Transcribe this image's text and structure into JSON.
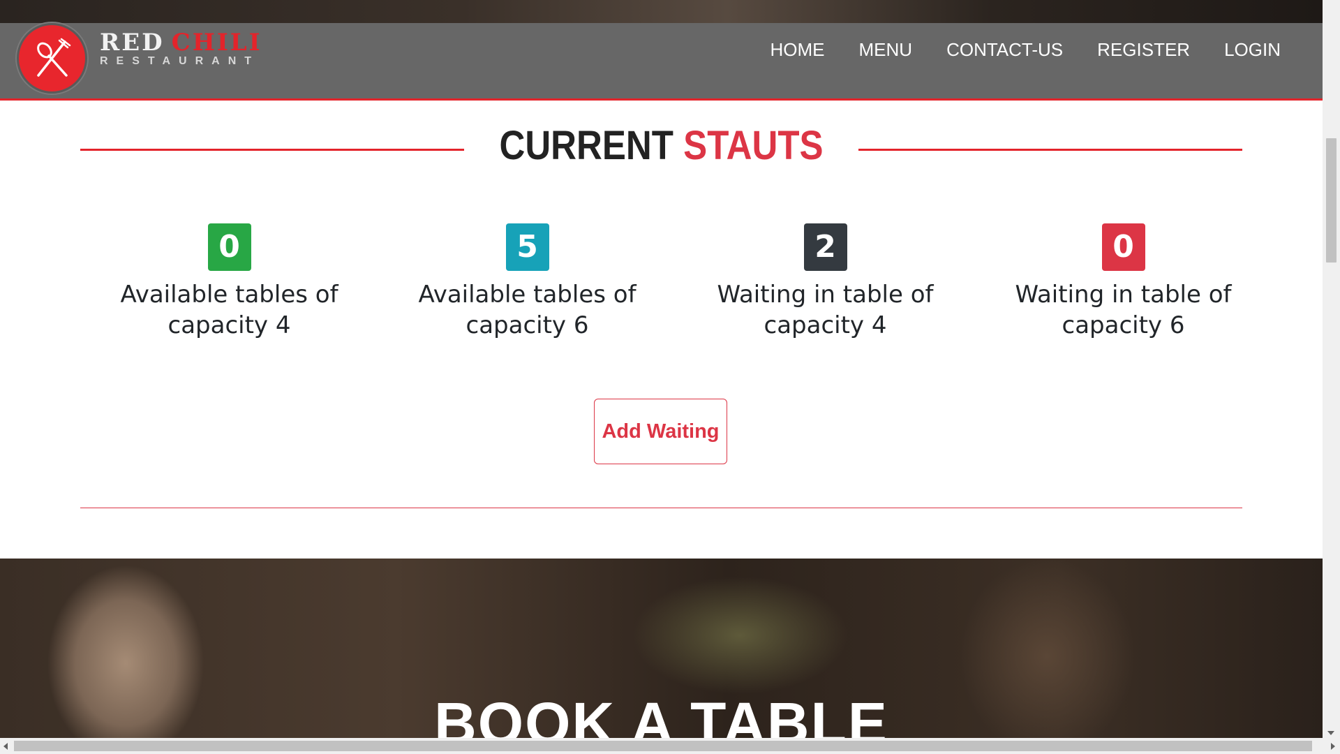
{
  "brand": {
    "name_part1": "RED",
    "name_part2": "CHILI",
    "subtitle": "RESTAURANT",
    "accent_color": "#e3242b",
    "logo_icon": "fork-spoon-icon"
  },
  "nav": {
    "items": [
      {
        "label": "HOME"
      },
      {
        "label": "MENU"
      },
      {
        "label": "CONTACT-US"
      },
      {
        "label": "REGISTER"
      },
      {
        "label": "LOGIN"
      }
    ]
  },
  "status": {
    "title_main": "CURRENT",
    "title_accent": "STAUTS",
    "cards": [
      {
        "value": "0",
        "label": "Available tables of capacity 4",
        "color": "#28a745"
      },
      {
        "value": "5",
        "label": "Available tables of capacity 6",
        "color": "#17a2b8"
      },
      {
        "value": "2",
        "label": "Waiting in table of capacity 4",
        "color": "#343a40"
      },
      {
        "value": "0",
        "label": "Waiting in table of capacity 6",
        "color": "#dc3545"
      }
    ],
    "add_button_label": "Add Waiting"
  },
  "book": {
    "title": "BOOK A TABLE"
  }
}
